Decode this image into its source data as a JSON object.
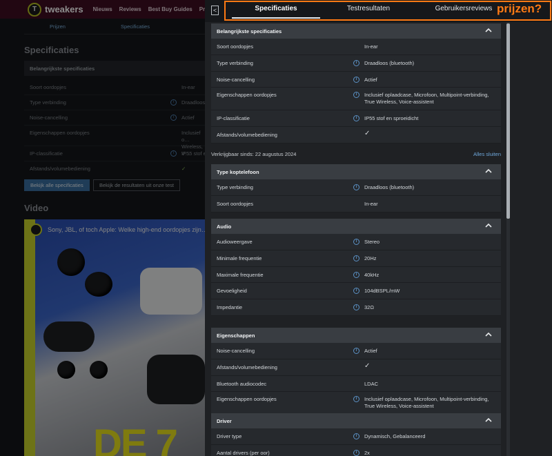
{
  "background_page": {
    "brand": "tweakers",
    "logo_letter": "T",
    "nav": [
      "Nieuws",
      "Reviews",
      "Best Buy Guides",
      "Pricewatch"
    ],
    "subnav": [
      "Prijzen",
      "Specificaties"
    ],
    "spec_heading": "Specificaties",
    "section_title": "Belangrijkste specificaties",
    "rows": [
      {
        "label": "Soort oordopjes",
        "value": "In-ear"
      },
      {
        "label": "Type verbinding",
        "value": "Draadloos"
      },
      {
        "label": "Noise-cancelling",
        "value": "Actief"
      },
      {
        "label": "Eigenschappen oordopjes",
        "value": "Inclusief o… Wireless, V…"
      },
      {
        "label": "IP-classificatie",
        "value": "IP55 stof e…"
      },
      {
        "label": "Afstands/volumebediening",
        "value": "✓"
      }
    ],
    "buttons": [
      "Bekijk alle specificaties",
      "Bekijk de resultaten uit onze test"
    ],
    "video_heading": "Video",
    "video_title": "Sony, JBL, of toch Apple: Welke high-end oordopjes zijn…",
    "video_overlay_text": "DE 7"
  },
  "panel": {
    "back_label": "<",
    "tabs": [
      "Specificaties",
      "Testresultaten",
      "Gebruikersreviews"
    ],
    "annotation": "prijzen?",
    "available_since": "Verkrijgbaar sinds: 22 augustus 2024",
    "close_all": "Alles sluiten",
    "info_glyph": "i",
    "sections": [
      {
        "title": "Belangrijkste specificaties",
        "rows": [
          {
            "label": "Soort oordopjes",
            "value": "In-ear"
          },
          {
            "label": "Type verbinding",
            "value": "Draadloos (bluetooth)",
            "info": true
          },
          {
            "label": "Noise-cancelling",
            "value": "Actief",
            "info": true
          },
          {
            "label": "Eigenschappen oordopjes",
            "value": "Inclusief oplaadcase, Microfoon, Multipoint-verbinding, True Wireless, Voice-assistent",
            "info": true
          },
          {
            "label": "IP-classificatie",
            "value": "IP55 stof en sproeidicht",
            "info": true
          },
          {
            "label": "Afstands/volumebediening",
            "value": "✓"
          }
        ]
      },
      {
        "title": "Type koptelefoon",
        "rows": [
          {
            "label": "Type verbinding",
            "value": "Draadloos (bluetooth)",
            "info": true
          },
          {
            "label": "Soort oordopjes",
            "value": "In-ear"
          }
        ]
      },
      {
        "title": "Audio",
        "rows": [
          {
            "label": "Audioweergave",
            "value": "Stereo",
            "info": true
          },
          {
            "label": "Minimale frequentie",
            "value": "20Hz",
            "info": true
          },
          {
            "label": "Maximale frequentie",
            "value": "40kHz",
            "info": true
          },
          {
            "label": "Gevoeligheid",
            "value": "104dBSPL/mW",
            "info": true
          },
          {
            "label": "Impedantie",
            "value": "32Ω",
            "info": true
          }
        ]
      },
      {
        "title": "Eigenschappen",
        "rows": [
          {
            "label": "Noise-cancelling",
            "value": "Actief",
            "info": true
          },
          {
            "label": "Afstands/volumebediening",
            "value": "✓"
          },
          {
            "label": "Bluetooth audiocodec",
            "value": "LDAC"
          },
          {
            "label": "Eigenschappen oordopjes",
            "value": "Inclusief oplaadcase, Microfoon, Multipoint-verbinding, True Wireless, Voice-assistent",
            "info": true
          }
        ]
      },
      {
        "title": "Driver",
        "rows": [
          {
            "label": "Driver type",
            "value": "Dynamisch, Gebalanceerd",
            "info": true
          },
          {
            "label": "Aantal drivers (per oor)",
            "value": "2x",
            "info": true
          }
        ]
      }
    ]
  },
  "colors": {
    "accent_orange": "#ff7a14",
    "link_blue": "#6fa8dc",
    "brand_bar": "#3f0e22"
  }
}
